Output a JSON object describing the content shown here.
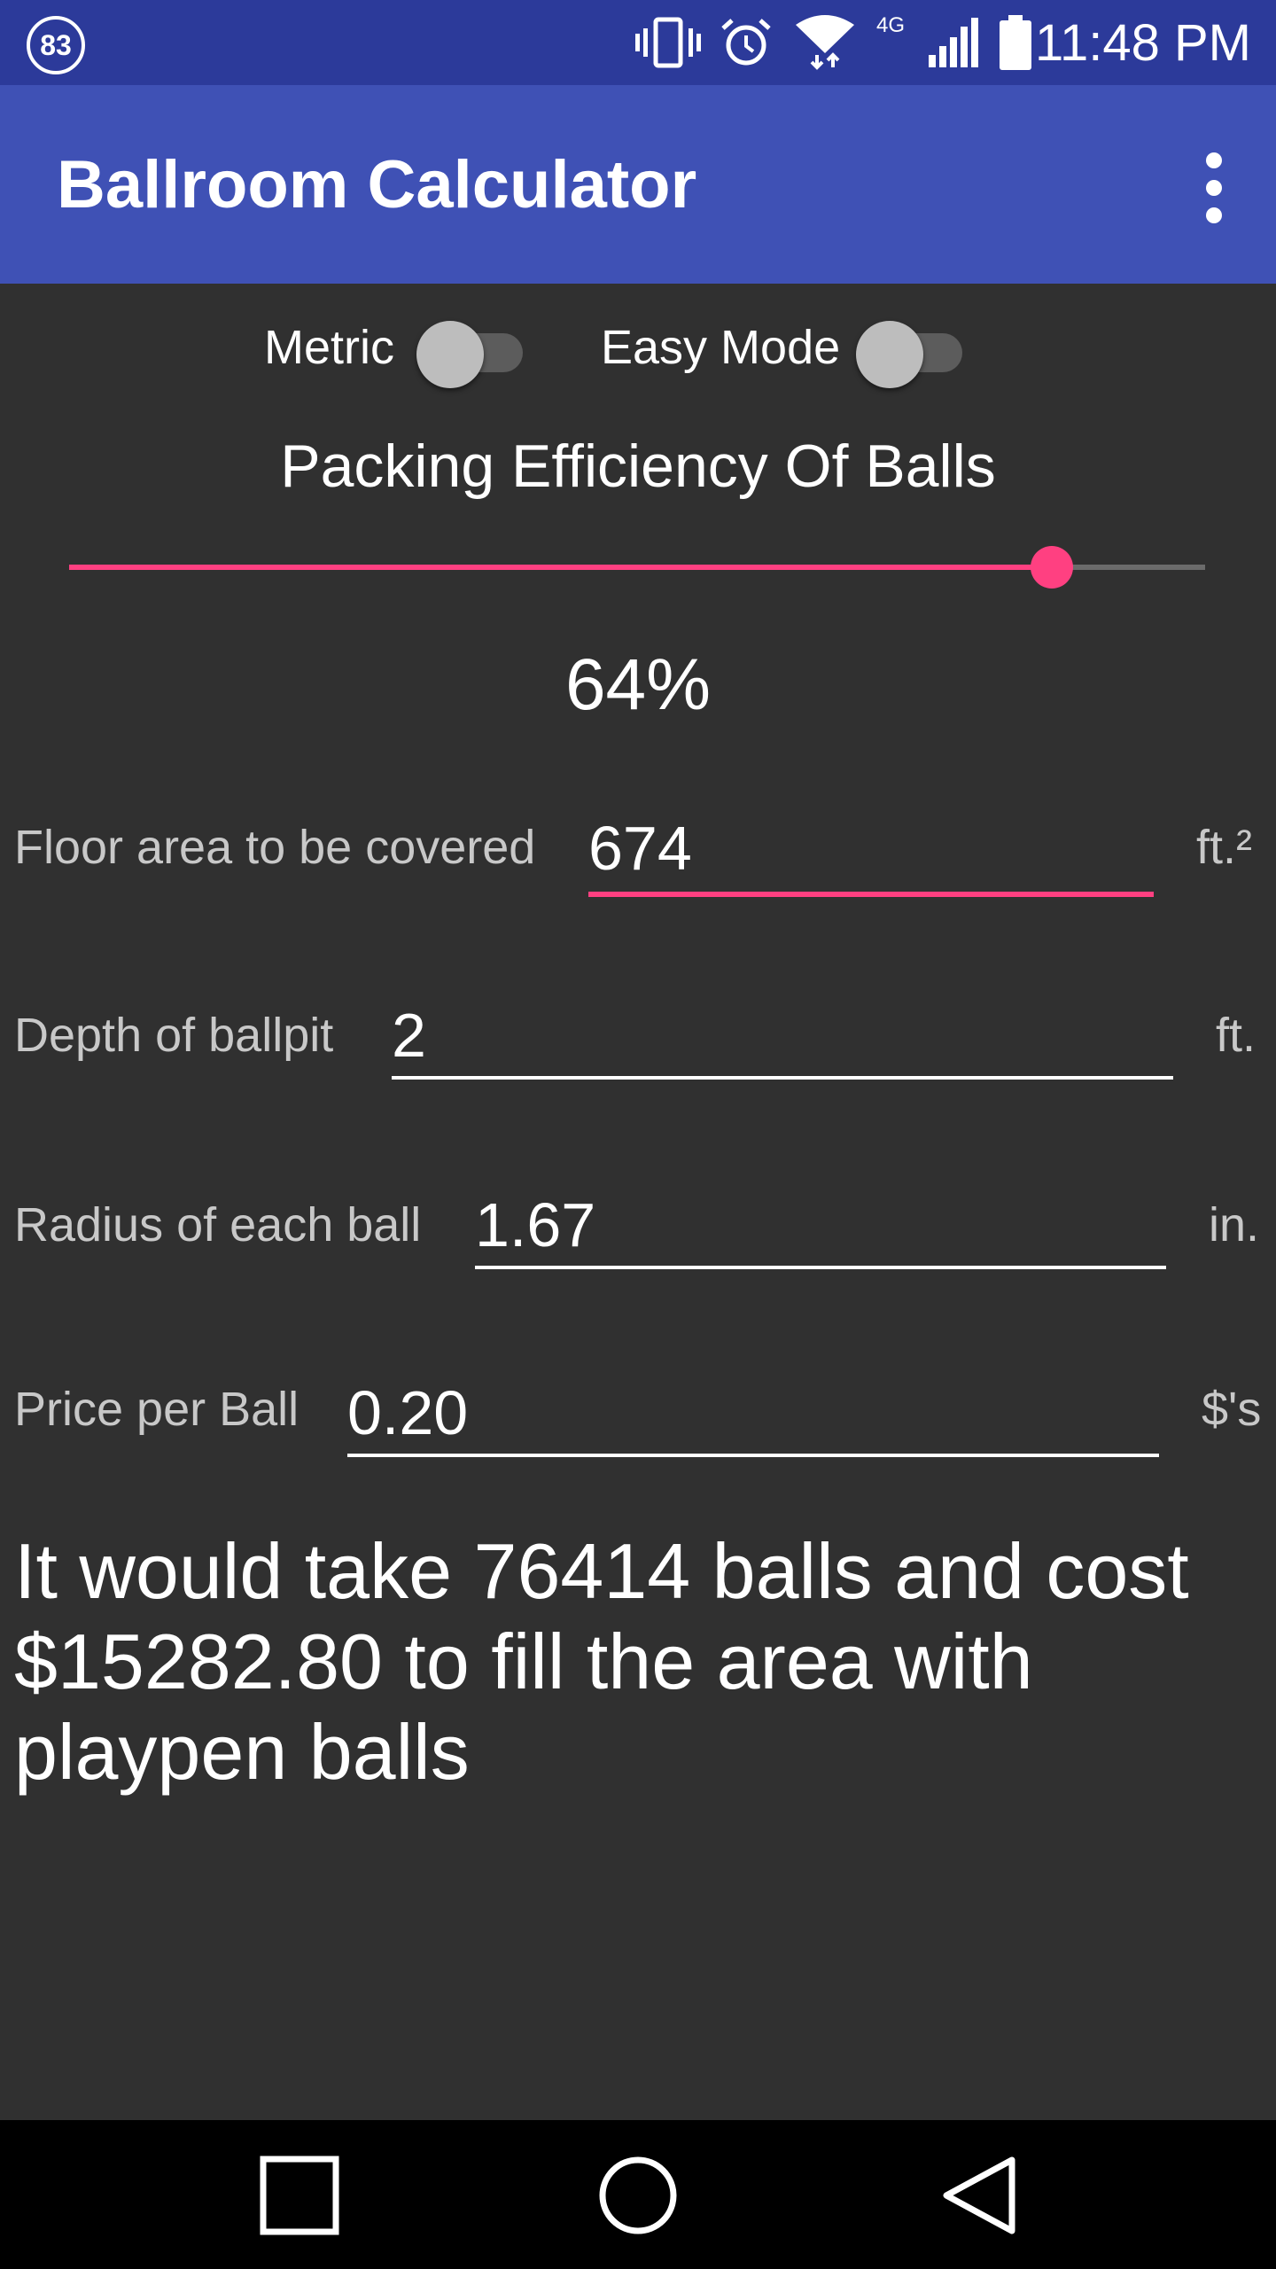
{
  "status_bar": {
    "notification_count": "83",
    "time": "11:48 PM",
    "network_label": "4G",
    "icons": [
      "vibrate-icon",
      "alarm-icon",
      "wifi-icon",
      "signal-icon",
      "battery-icon"
    ]
  },
  "app_bar": {
    "title": "Ballroom Calculator",
    "menu_icon": "overflow-menu-icon"
  },
  "toggles": {
    "metric_label": "Metric",
    "metric_on": false,
    "easy_mode_label": "Easy Mode",
    "easy_mode_on": false
  },
  "packing": {
    "title": "Packing Efficiency Of Balls",
    "value_text": "64%",
    "slider_fraction": 0.865
  },
  "fields": {
    "floor_area": {
      "label": "Floor area to be covered",
      "value": "674",
      "unit": "ft.²"
    },
    "depth": {
      "label": "Depth of ballpit",
      "value": "2",
      "unit": "ft."
    },
    "radius": {
      "label": "Radius of each ball",
      "value": "1.67",
      "unit": "in."
    },
    "price": {
      "label": "Price per Ball",
      "value": "0.20",
      "unit": "$'s"
    }
  },
  "result_text": "It would take 76414 balls and cost $15282.80 to fill the area with playpen balls",
  "nav_bar": {
    "icons": [
      "recents-icon",
      "home-icon",
      "back-icon"
    ]
  },
  "colors": {
    "status_bar": "#2c3a9a",
    "app_bar": "#3f51b5",
    "background": "#303030",
    "accent": "#ff4081"
  }
}
